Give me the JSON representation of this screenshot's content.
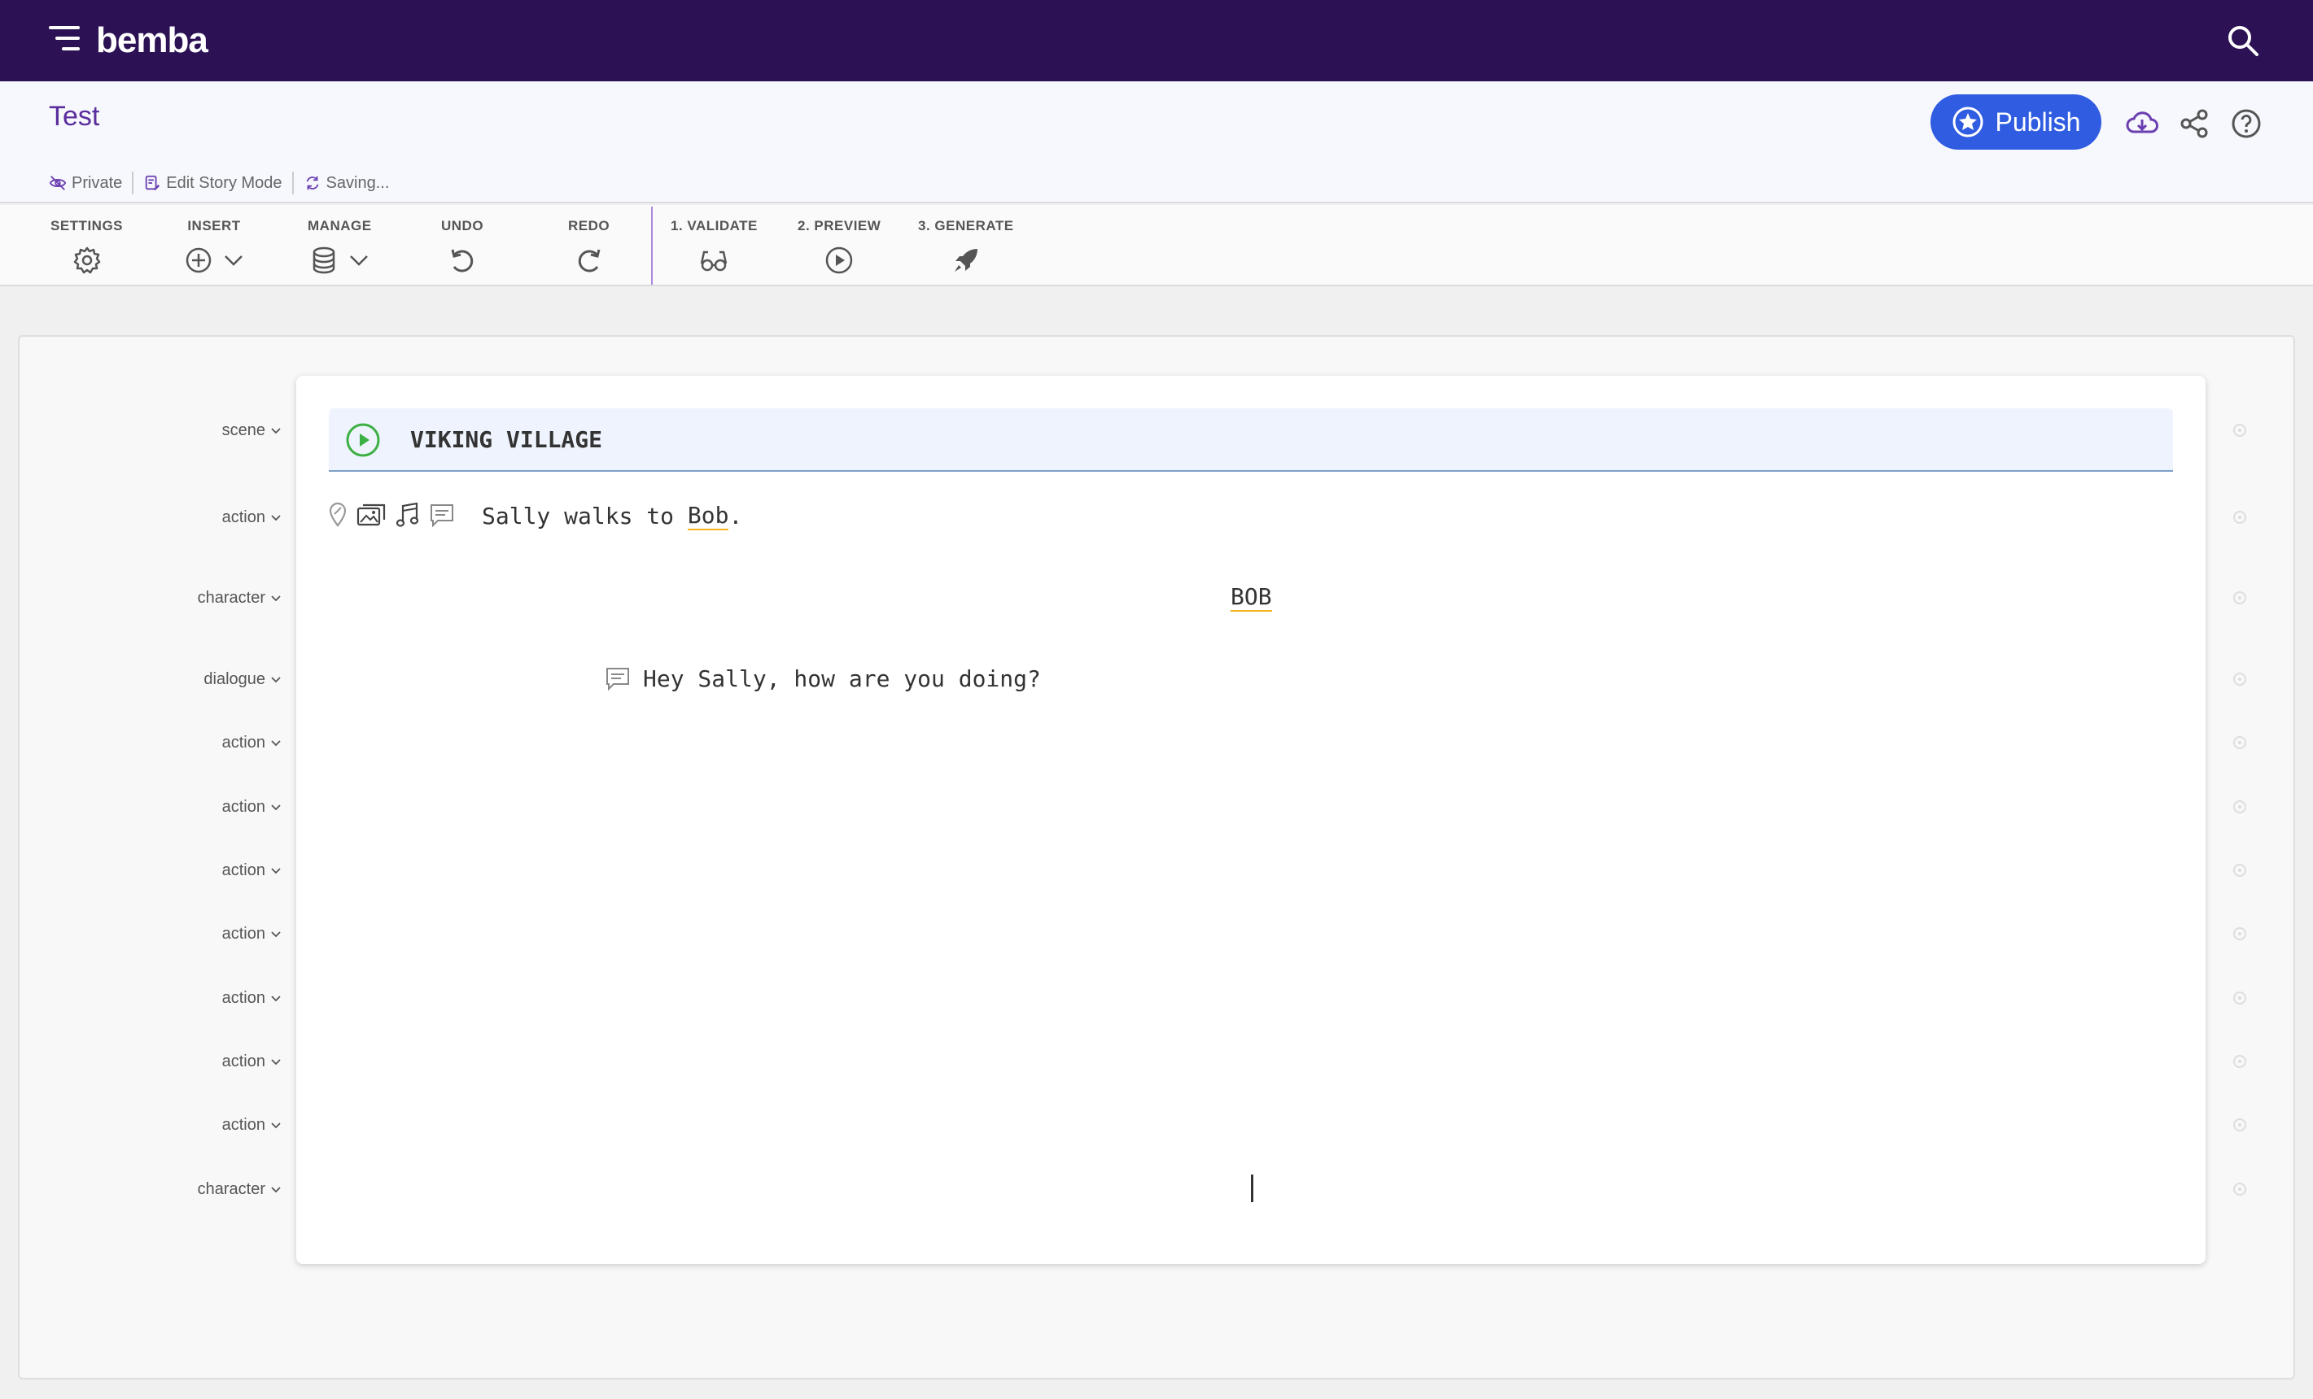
{
  "app": {
    "logo_text": "bemba",
    "brand_color": "#2c1254",
    "accent_color": "#2f5ce0"
  },
  "document": {
    "title": "Test",
    "meta": {
      "visibility": "Private",
      "mode": "Edit Story Mode",
      "status": "Saving..."
    }
  },
  "actions": {
    "publish_label": "Publish"
  },
  "toolbar": {
    "settings": "SETTINGS",
    "insert": "INSERT",
    "manage": "MANAGE",
    "undo": "UNDO",
    "redo": "REDO",
    "validate": "1. VALIDATE",
    "preview": "2. PREVIEW",
    "generate": "3. GENERATE"
  },
  "script": {
    "scene_heading": "VIKING VILLAGE",
    "rows": [
      {
        "type": "scene"
      },
      {
        "type": "action",
        "text": "Sally walks to ",
        "mention": "Bob",
        "suffix": "."
      },
      {
        "type": "character",
        "text": "BOB"
      },
      {
        "type": "dialogue",
        "text": "Hey Sally, how are you doing?"
      },
      {
        "type": "action"
      },
      {
        "type": "action"
      },
      {
        "type": "action"
      },
      {
        "type": "action"
      },
      {
        "type": "action"
      },
      {
        "type": "action"
      },
      {
        "type": "action"
      },
      {
        "type": "character"
      }
    ]
  }
}
